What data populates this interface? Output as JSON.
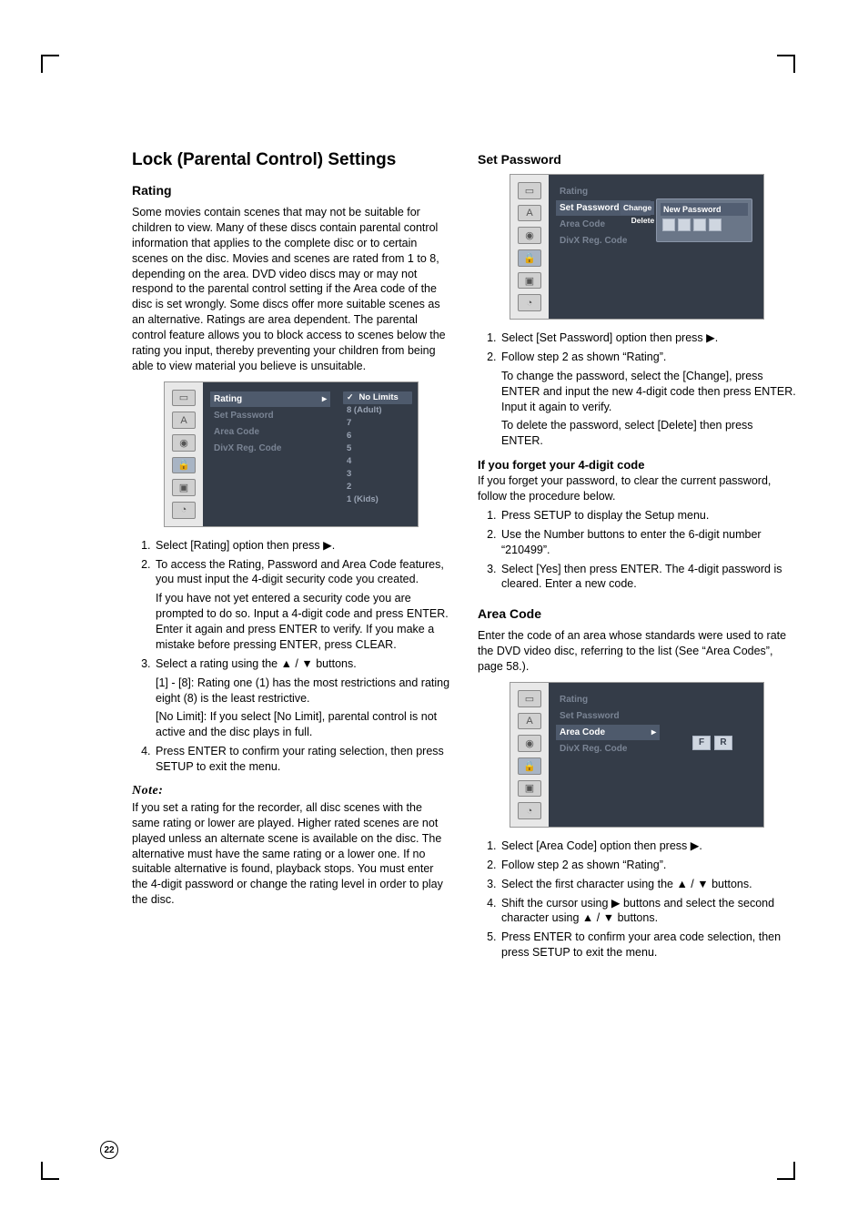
{
  "cropMarks": true,
  "pageNumber": "22",
  "left": {
    "title": "Lock (Parental Control) Settings",
    "ratingHeading": "Rating",
    "ratingIntro": "Some movies contain scenes that may not be suitable for children to view. Many of these discs contain parental control information that applies to the complete disc or to certain scenes on the disc. Movies and scenes are rated from 1 to 8, depending on the area. DVD video discs may or may not respond to the parental control setting if the Area code of the disc is set wrongly. Some discs offer more suitable scenes as an alternative. Ratings are area dependent. The parental control feature allows you to block access to scenes below the rating you input, thereby preventing your children from being able to view material you believe is unsuitable.",
    "shot": {
      "items": [
        "Rating",
        "Set Password",
        "Area Code",
        "DivX Reg. Code"
      ],
      "currentItem": "Rating",
      "options": [
        "No Limits",
        "8   (Adult)",
        "7",
        "6",
        "5",
        "4",
        "3",
        "2",
        "1   (Kids)"
      ],
      "currentOption": "No Limits"
    },
    "steps": [
      {
        "text": "Select [Rating] option then press ▶."
      },
      {
        "text": "To access the Rating, Password and Area Code features, you must input the 4-digit security code you created.",
        "extra": "If you have not yet entered a security code you are prompted to do so. Input a 4-digit code and press ENTER. Enter it again and press ENTER to verify. If you make a mistake before pressing ENTER, press CLEAR."
      },
      {
        "text": "Select a rating using the ▲ / ▼ buttons.",
        "sub1": "[1] - [8]: Rating one (1) has the most restrictions and rating eight (8) is the least restrictive.",
        "sub2": "[No Limit]: If you select [No Limit], parental control is not active and the disc plays in full."
      },
      {
        "text": "Press ENTER to confirm your rating selection, then press SETUP to exit the menu."
      }
    ],
    "noteLabel": "Note:",
    "noteText": "If you set a rating for the recorder, all disc scenes with the same rating or lower are played. Higher rated scenes are not played unless an alternate scene is available on the disc. The alternative must have the same rating or a lower one. If no suitable alternative is found, playback stops. You must enter the 4-digit password or change the rating level in order to play the disc."
  },
  "right": {
    "pwHeading": "Set Password",
    "pwShot": {
      "items": [
        "Rating",
        "Set Password",
        "Area Code",
        "DivX Reg. Code"
      ],
      "currentItem": "Set Password",
      "sideOptions": [
        "Change",
        "Delete"
      ],
      "popupTitle": "New Password"
    },
    "pwSteps": [
      {
        "text": "Select [Set Password] option then press ▶."
      },
      {
        "text": "Follow step 2 as shown “Rating”.",
        "extra1": "To change the password, select the [Change], press ENTER and input the new 4-digit code then press ENTER. Input it again to verify.",
        "extra2": "To delete the password, select [Delete] then press ENTER."
      }
    ],
    "forgetHeading": "If you forget your 4-digit code",
    "forgetIntro": "If you forget your password, to clear the current password, follow the procedure below.",
    "forgetSteps": [
      "Press SETUP to display the Setup menu.",
      "Use the Number buttons to enter the 6-digit number “210499”.",
      "Select [Yes] then press ENTER. The 4-digit password is cleared. Enter a new code."
    ],
    "areaHeading": "Area Code",
    "areaIntro": "Enter the code of an area whose standards were used to rate the DVD video disc, referring to the list (See “Area Codes”, page 58.).",
    "areaShot": {
      "items": [
        "Rating",
        "Set Password",
        "Area Code",
        "DivX Reg. Code"
      ],
      "currentItem": "Area Code",
      "chars": [
        "F",
        "R"
      ]
    },
    "areaSteps": [
      "Select [Area Code] option then press ▶.",
      "Follow step 2 as shown “Rating”.",
      "Select the first character using the ▲ / ▼ buttons.",
      "Shift the cursor using ▶ buttons and select the second character using ▲ / ▼ buttons.",
      "Press ENTER to confirm your area code selection, then press SETUP to exit the menu."
    ]
  }
}
